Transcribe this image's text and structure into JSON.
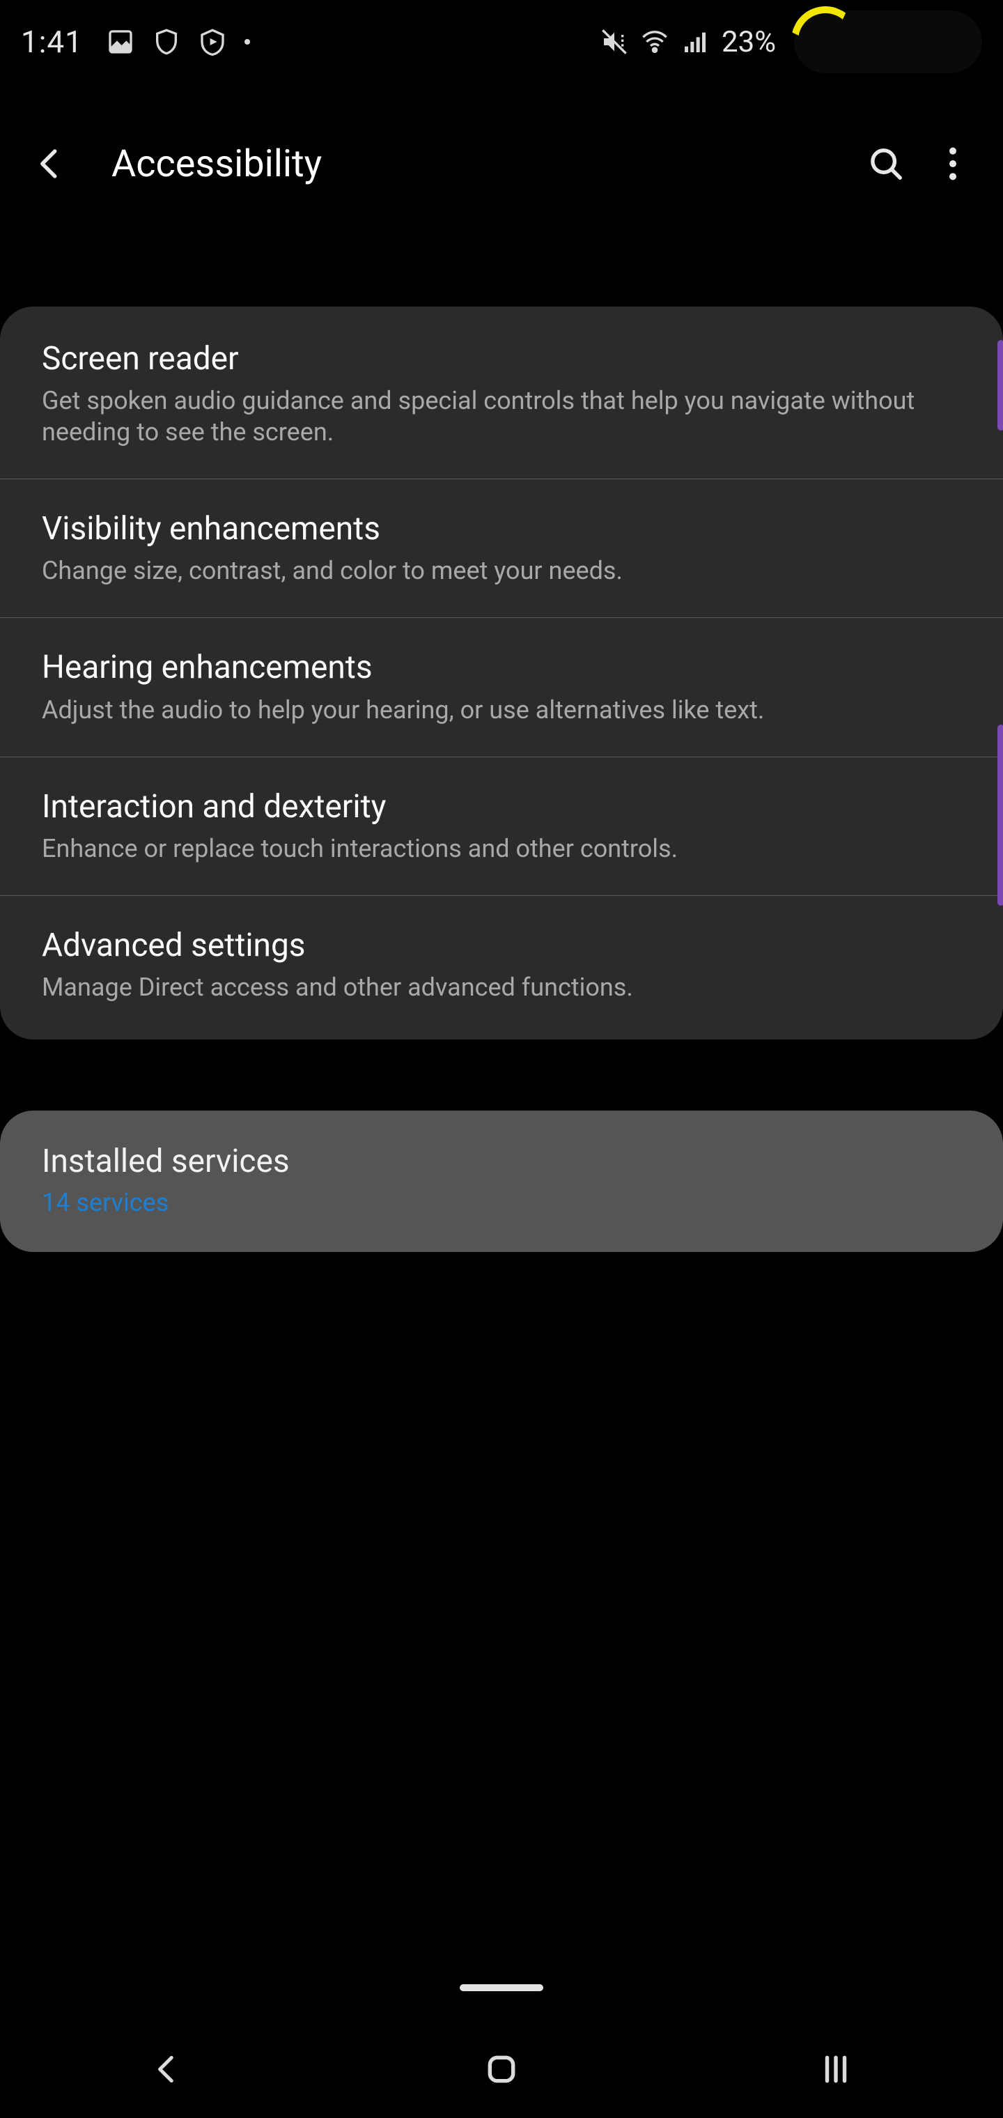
{
  "status": {
    "time": "1:41",
    "battery_percent": "23%",
    "icons": [
      "picture-icon",
      "shield-icon",
      "play-protect-icon",
      "dot-icon"
    ],
    "right_icons": [
      "silent-vibrate-icon",
      "wifi-icon",
      "signal-icon"
    ]
  },
  "header": {
    "title": "Accessibility"
  },
  "sections": [
    {
      "id": "main",
      "items": [
        {
          "title": "Screen reader",
          "desc": "Get spoken audio guidance and special controls that help you navigate without needing to see the screen."
        },
        {
          "title": "Visibility enhancements",
          "desc": "Change size, contrast, and color to meet your needs."
        },
        {
          "title": "Hearing enhancements",
          "desc": "Adjust the audio to help your hearing, or use alternatives like text."
        },
        {
          "title": "Interaction and dexterity",
          "desc": "Enhance or replace touch interactions and other controls."
        },
        {
          "title": "Advanced settings",
          "desc": "Manage Direct access and other advanced functions."
        }
      ]
    },
    {
      "id": "services",
      "items": [
        {
          "title": "Installed services",
          "link": "14 services"
        }
      ]
    }
  ]
}
